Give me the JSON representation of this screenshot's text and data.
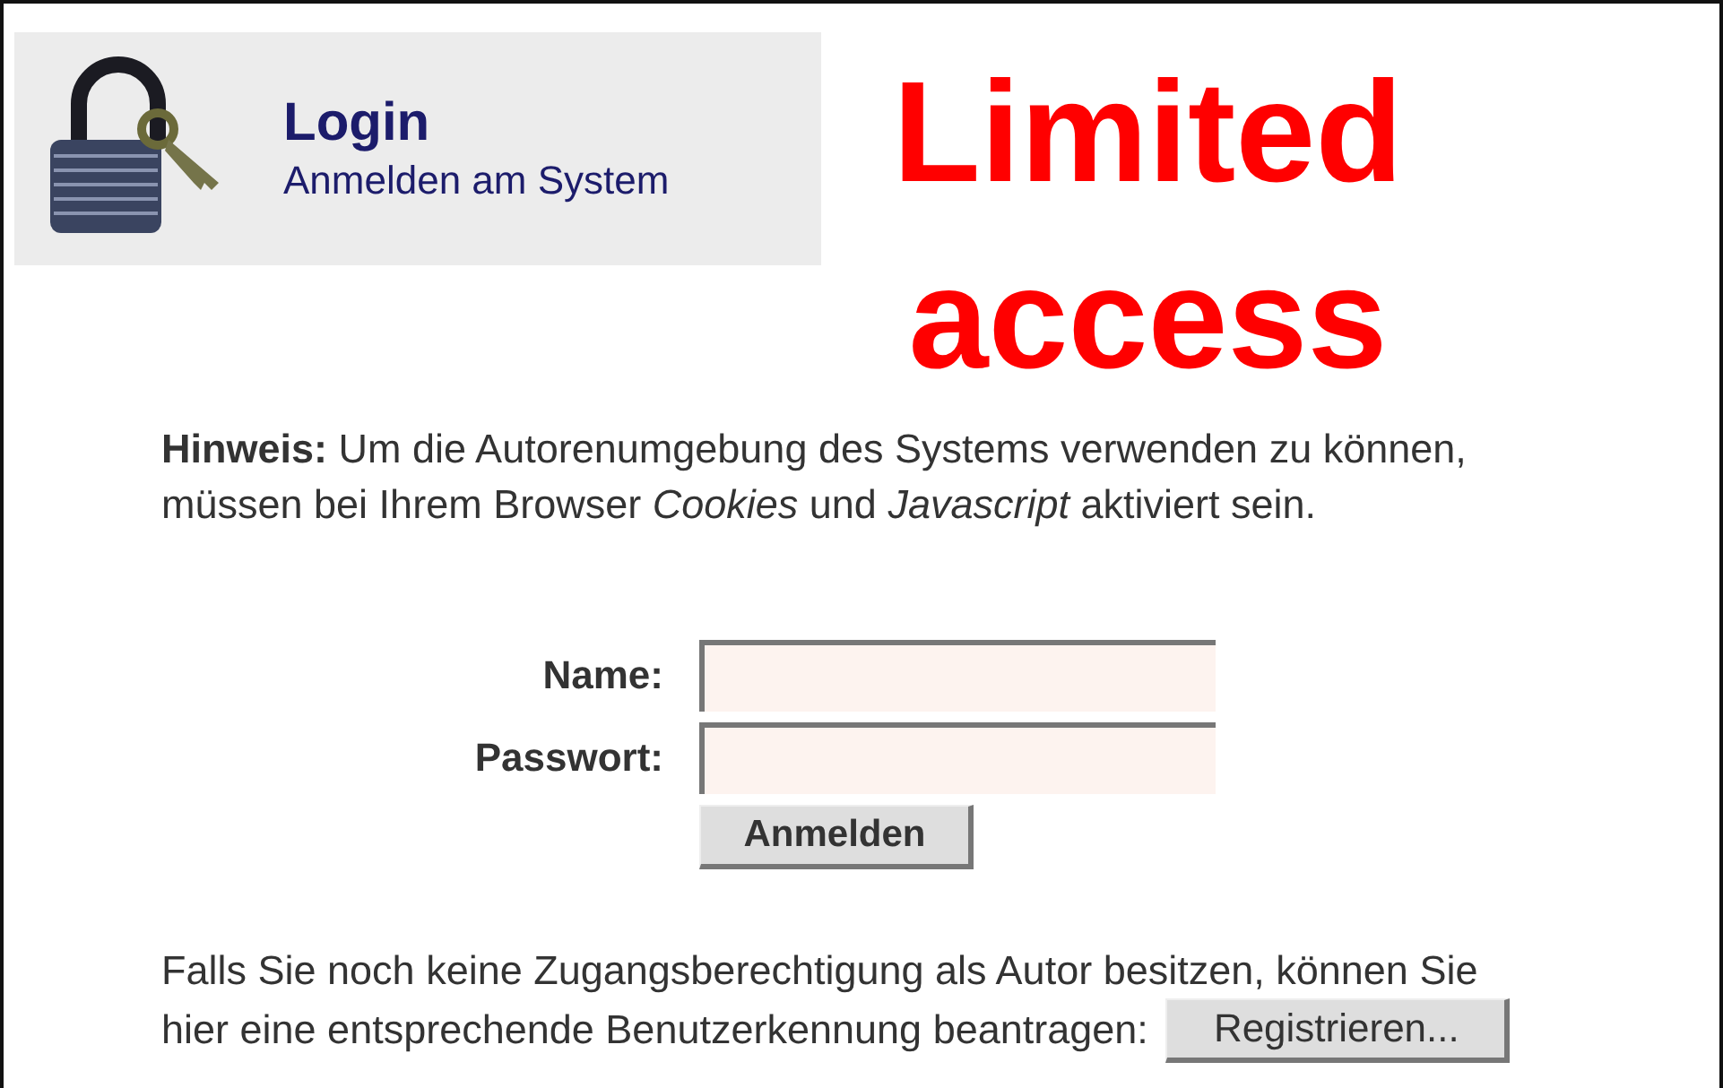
{
  "header": {
    "title": "Login",
    "subtitle": "Anmelden am System"
  },
  "annotation": {
    "lines": [
      "Limited",
      "access"
    ]
  },
  "notice": "**Hinweis:** Um die Autorenumgebung des Systems verwenden zu können, müssen bei Ihrem Browser *Cookies* und *Javascript* aktiviert sein.",
  "form": {
    "fields": [
      {
        "label": "Name:"
      },
      {
        "label": "Passwort:"
      }
    ],
    "submit": "Anmelden"
  },
  "register": {
    "lines": [
      "Falls Sie noch keine Zugangsberechtigung als Autor besitzen, können Sie",
      "hier eine entsprechende Benutzerkennung beantragen:"
    ],
    "button": "Registrieren..."
  }
}
